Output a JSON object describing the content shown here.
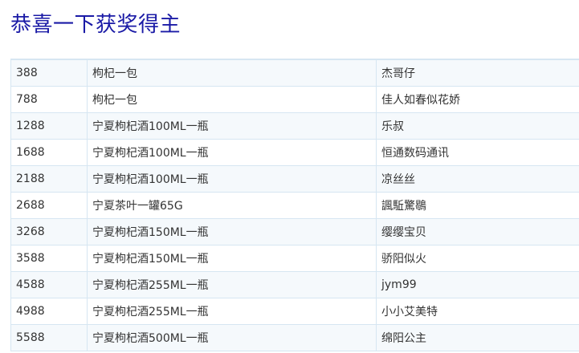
{
  "page": {
    "title": "恭喜一下获奖得主"
  },
  "winners": [
    {
      "number": "388",
      "prize": "枸杞一包",
      "name": "杰哥仔"
    },
    {
      "number": "788",
      "prize": "枸杞一包",
      "name": "佳人如春似花娇"
    },
    {
      "number": "1288",
      "prize": "宁夏枸杞酒100ML一瓶",
      "name": "乐叔"
    },
    {
      "number": "1688",
      "prize": "宁夏枸杞酒100ML一瓶",
      "name": "恒通数码通讯"
    },
    {
      "number": "2188",
      "prize": "宁夏枸杞酒100ML一瓶",
      "name": "凉丝丝"
    },
    {
      "number": "2688",
      "prize": "宁夏茶叶一罐65G",
      "name": "諷駈驚鶡"
    },
    {
      "number": "3268",
      "prize": "宁夏枸杞酒150ML一瓶",
      "name": "缨缨宝贝"
    },
    {
      "number": "3588",
      "prize": "宁夏枸杞酒150ML一瓶",
      "name": "骄阳似火"
    },
    {
      "number": "4588",
      "prize": "宁夏枸杞酒255ML一瓶",
      "name": "jym99"
    },
    {
      "number": "4988",
      "prize": "宁夏枸杞酒255ML一瓶",
      "name": "小小艾美特"
    },
    {
      "number": "5588",
      "prize": "宁夏枸杞酒500ML一瓶",
      "name": "绵阳公主"
    }
  ]
}
